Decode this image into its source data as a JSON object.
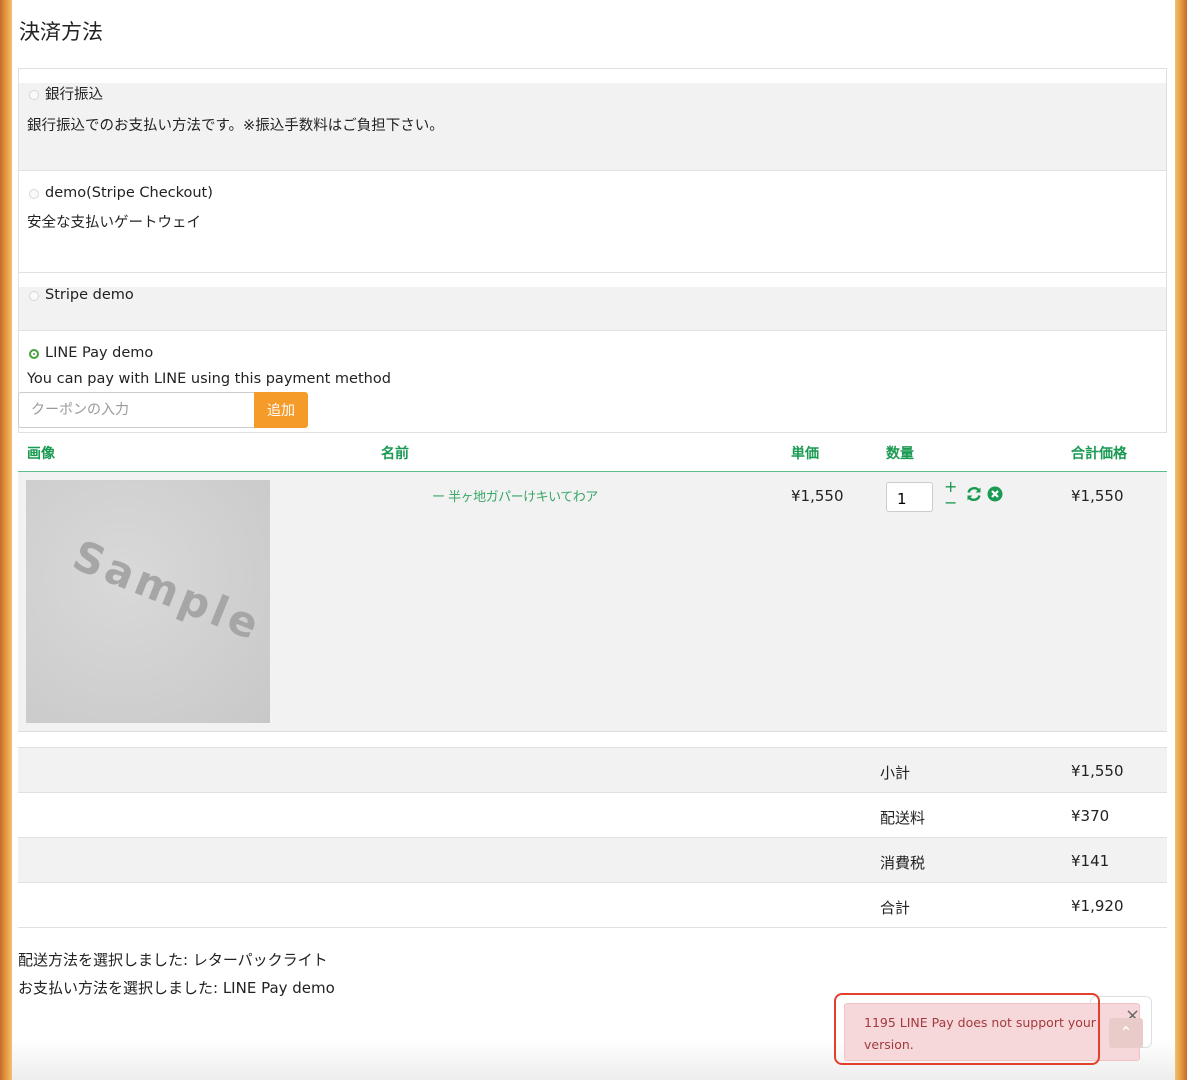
{
  "page_title": "決済方法",
  "payment_methods": [
    {
      "label": "銀行振込",
      "description": "銀行振込でのお支払い方法です。※振込手数料はご負担下さい。",
      "selected": false
    },
    {
      "label": "demo(Stripe Checkout)",
      "description": "安全な支払いゲートウェイ",
      "selected": false
    },
    {
      "label": "Stripe demo",
      "description": "",
      "selected": false
    },
    {
      "label": "LINE Pay demo",
      "description": "You can pay with LINE using this payment method",
      "selected": true
    }
  ],
  "coupon": {
    "placeholder": "クーポンの入力",
    "button_label": "追加"
  },
  "cart": {
    "headers": {
      "image": "画像",
      "name": "名前",
      "unit_price": "単価",
      "quantity": "数量",
      "total": "合計価格"
    },
    "items": [
      {
        "image_text": "Sample",
        "name": "ー 半ヶ地ガパーけキいてわア",
        "unit_price": "¥1,550",
        "quantity": "1",
        "line_total": "¥1,550"
      }
    ],
    "plus_symbol": "+",
    "minus_symbol": "−"
  },
  "totals": [
    {
      "label": "小計",
      "value": "¥1,550"
    },
    {
      "label": "配送料",
      "value": "¥370"
    },
    {
      "label": "消費税",
      "value": "¥141"
    },
    {
      "label": "合計",
      "value": "¥1,920"
    }
  ],
  "summary": {
    "shipping": "配送方法を選択しました: レターパックライト",
    "payment": "お支払い方法を選択しました: LINE Pay demo"
  },
  "alert": {
    "message": "1195 LINE Pay does not support your version.",
    "close_symbol": "×",
    "top_symbol": "⌃"
  },
  "colors": {
    "accent_green": "#1a9a52",
    "button_orange": "#f59b2a",
    "alert_bg": "#f7d8da",
    "alert_text": "#a33a3e",
    "highlight_red": "#e2402d"
  }
}
